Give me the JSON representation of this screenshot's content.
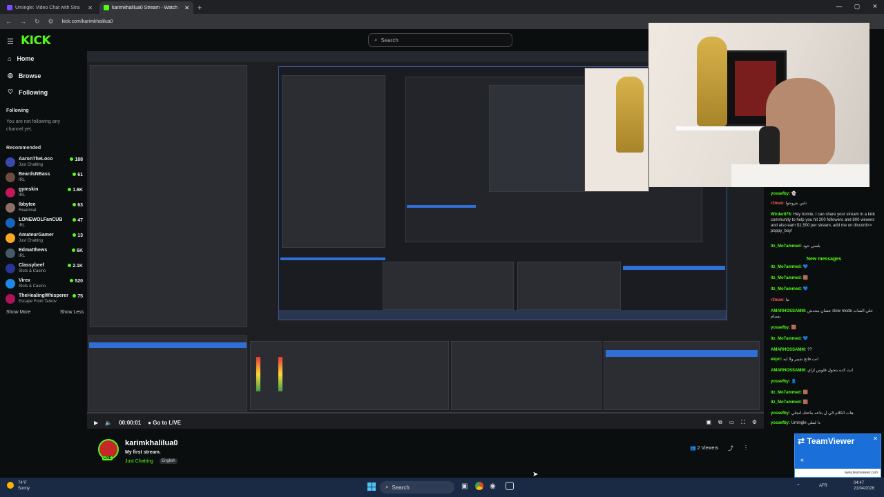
{
  "browser": {
    "tabs": [
      {
        "label": "Umingle: Video Chat with Stra",
        "active": false
      },
      {
        "label": "karimkhalilua0 Stream - Watch",
        "active": true
      }
    ],
    "new_tab": "+",
    "url": "kick.com/karimkhalilua0",
    "window_controls": [
      "—",
      "▢",
      "✕"
    ]
  },
  "header": {
    "logo": "KICK",
    "search_placeholder": "Search"
  },
  "sidebar": {
    "nav": [
      {
        "label": "Home",
        "icon": "home-icon"
      },
      {
        "label": "Browse",
        "icon": "compass-icon"
      },
      {
        "label": "Following",
        "icon": "heart-icon"
      }
    ],
    "following_title": "Following",
    "following_empty": "You are not following any channel yet.",
    "recommended_title": "Recommended",
    "recommended": [
      {
        "name": "AaronTheLoco",
        "category": "Just Chatting",
        "viewers": "188",
        "color": "#3949ab"
      },
      {
        "name": "BeardsNBass",
        "category": "IRL",
        "viewers": "61",
        "color": "#6d4c41"
      },
      {
        "name": "gymskin",
        "category": "IRL",
        "viewers": "1.6K",
        "color": "#c2185b"
      },
      {
        "name": "Ibbytee",
        "category": "Reanimal",
        "viewers": "63",
        "color": "#8d6e63"
      },
      {
        "name": "LONEWOLFanCUB",
        "category": "IRL",
        "viewers": "47",
        "color": "#1565c0"
      },
      {
        "name": "AmateurGamer",
        "category": "Just Chatting",
        "viewers": "13",
        "color": "#f9a825"
      },
      {
        "name": "Edmatthews",
        "category": "IRL",
        "viewers": "6K",
        "color": "#455a64"
      },
      {
        "name": "Classybeef",
        "category": "Slots & Casino",
        "viewers": "2.1K",
        "color": "#283593"
      },
      {
        "name": "Virex",
        "category": "Slots & Casino",
        "viewers": "520",
        "color": "#1e88e5"
      },
      {
        "name": "TheHealingWhisperer",
        "category": "Escape From Tarkov",
        "viewers": "75",
        "color": "#ad1457"
      }
    ],
    "show_more": "Show More",
    "show_less": "Show Less"
  },
  "player": {
    "time": "00:00:01",
    "go_live": "Go to LIVE"
  },
  "stream": {
    "channel": "karimkhalilua0",
    "title": "My first stream.",
    "category": "Just Chatting",
    "language": "English",
    "viewers": "2 Viewers",
    "live_badge": "LIVE"
  },
  "chat": {
    "new_messages": "New messages",
    "messages": [
      {
        "user": "yossefby:",
        "text": "👻",
        "red": false
      },
      {
        "user": "r3man:",
        "text": "ناس بتروحوا",
        "red": true
      },
      {
        "user": "Wirder876:",
        "text": "Hey homie, I can share your stream in a kick community to help you hit 200 followers and 800 viewers and also earn $1,500 per stream, add me on discord>> poppy_boy!",
        "red": false
      },
      {
        "user": "itz_Mo7ammed:",
        "text": "بلسي حود",
        "red": false
      },
      {
        "user": "itz_Mo7ammed:",
        "text": "💙",
        "red": false
      },
      {
        "user": "itz_Mo7ammed:",
        "text": "🟫",
        "red": false
      },
      {
        "user": "itz_Mo7ammed:",
        "text": "💙",
        "red": false
      },
      {
        "user": "r3man:",
        "text": "ما",
        "red": true
      },
      {
        "user": "AMARHOSSAMM:",
        "text": "عشان محدش slow mode خلي الشات يسبام",
        "red": false
      },
      {
        "user": "yossefby:",
        "text": "🟫",
        "red": false
      },
      {
        "user": "itz_Mo7ammed:",
        "text": "💙",
        "red": false
      },
      {
        "user": "AMARHOSSAMM:",
        "text": "??",
        "red": false
      },
      {
        "user": "elqot:",
        "text": "انت فاتح شيبر ولا ايه",
        "red": false
      },
      {
        "user": "AMARHOSSAMM:",
        "text": "انت كده بتحول فلوس ازاي",
        "red": false
      },
      {
        "user": "yossefby:",
        "text": "👤",
        "red": false
      },
      {
        "user": "itz_Mo7ammed:",
        "text": "🟫",
        "red": false
      },
      {
        "user": "itz_Mo7ammed:",
        "text": "🟫",
        "red": false
      },
      {
        "user": "yossefby:",
        "text": "هات الكلام الي ل بتاعه بتاعتك لنجلي",
        "red": false
      },
      {
        "user": "yossefby:",
        "text": "Umingle دا لبتلي",
        "red": false
      }
    ]
  },
  "teamviewer": {
    "brand": "TeamViewer",
    "url": "www.teamviewer.com"
  },
  "taskbar": {
    "weather_temp": "74°F",
    "weather_desc": "Sunny",
    "search": "Search",
    "lang": "AFR",
    "time": "04:47",
    "date": "21/04/2026"
  }
}
